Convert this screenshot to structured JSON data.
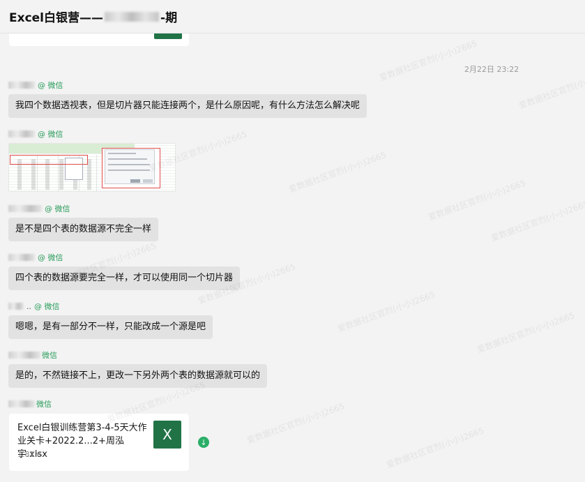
{
  "window": {
    "title_prefix": "Excel白银营——",
    "title_suffix": "-期"
  },
  "chat": {
    "timestamp": "2月22日 23:22",
    "source_tag": "@ 微信",
    "source_tag_short": "微信",
    "messages": [
      {
        "type": "text",
        "text": "我四个数据透视表，但是切片器只能连接两个，是什么原因呢，有什么方法怎么解决呢"
      },
      {
        "type": "image"
      },
      {
        "type": "text",
        "text": "是不是四个表的数据源不完全一样"
      },
      {
        "type": "text",
        "text": "四个表的数据源要完全一样，才可以使用同一个切片器"
      },
      {
        "type": "text",
        "text": "嗯嗯，是有一部分不一样，只能改成一个源是吧"
      },
      {
        "type": "text",
        "text": "是的，不然链接不上，更改一下另外两个表的数据源就可以的"
      }
    ],
    "file": {
      "name": "Excel白银训练营第3-4-5天大作业关卡+2022.2...2+周泓宇.xlsx",
      "size": "1.81M",
      "icon_letter": "X"
    },
    "sender_suffix_4": "..",
    "download_glyph": "↓"
  },
  "watermark": {
    "text": "爱数据社区官烈(小小)2665"
  },
  "colors": {
    "background": "#f3f3f3",
    "bubble": "#e2e2e3",
    "source_green": "#2a9d5c",
    "excel_green": "#217346",
    "download_green": "#2aae67"
  }
}
